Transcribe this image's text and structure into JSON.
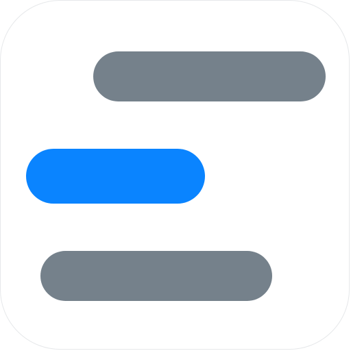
{
  "app_icon": {
    "icon_name": "align-lines-icon",
    "colors": {
      "tile_background": "#ffffff",
      "tile_border": "#e6e8ea",
      "gray_bar": "#75818b",
      "accent_bar": "#0a84ff"
    }
  }
}
